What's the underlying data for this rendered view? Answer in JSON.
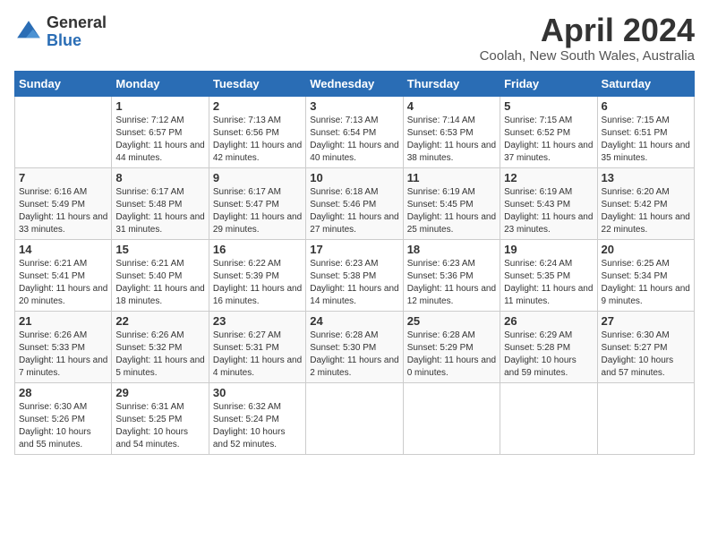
{
  "header": {
    "logo_general": "General",
    "logo_blue": "Blue",
    "month_title": "April 2024",
    "location": "Coolah, New South Wales, Australia"
  },
  "calendar": {
    "weekdays": [
      "Sunday",
      "Monday",
      "Tuesday",
      "Wednesday",
      "Thursday",
      "Friday",
      "Saturday"
    ],
    "weeks": [
      [
        {
          "day": "",
          "sunrise": "",
          "sunset": "",
          "daylight": ""
        },
        {
          "day": "1",
          "sunrise": "Sunrise: 7:12 AM",
          "sunset": "Sunset: 6:57 PM",
          "daylight": "Daylight: 11 hours and 44 minutes."
        },
        {
          "day": "2",
          "sunrise": "Sunrise: 7:13 AM",
          "sunset": "Sunset: 6:56 PM",
          "daylight": "Daylight: 11 hours and 42 minutes."
        },
        {
          "day": "3",
          "sunrise": "Sunrise: 7:13 AM",
          "sunset": "Sunset: 6:54 PM",
          "daylight": "Daylight: 11 hours and 40 minutes."
        },
        {
          "day": "4",
          "sunrise": "Sunrise: 7:14 AM",
          "sunset": "Sunset: 6:53 PM",
          "daylight": "Daylight: 11 hours and 38 minutes."
        },
        {
          "day": "5",
          "sunrise": "Sunrise: 7:15 AM",
          "sunset": "Sunset: 6:52 PM",
          "daylight": "Daylight: 11 hours and 37 minutes."
        },
        {
          "day": "6",
          "sunrise": "Sunrise: 7:15 AM",
          "sunset": "Sunset: 6:51 PM",
          "daylight": "Daylight: 11 hours and 35 minutes."
        }
      ],
      [
        {
          "day": "7",
          "sunrise": "Sunrise: 6:16 AM",
          "sunset": "Sunset: 5:49 PM",
          "daylight": "Daylight: 11 hours and 33 minutes."
        },
        {
          "day": "8",
          "sunrise": "Sunrise: 6:17 AM",
          "sunset": "Sunset: 5:48 PM",
          "daylight": "Daylight: 11 hours and 31 minutes."
        },
        {
          "day": "9",
          "sunrise": "Sunrise: 6:17 AM",
          "sunset": "Sunset: 5:47 PM",
          "daylight": "Daylight: 11 hours and 29 minutes."
        },
        {
          "day": "10",
          "sunrise": "Sunrise: 6:18 AM",
          "sunset": "Sunset: 5:46 PM",
          "daylight": "Daylight: 11 hours and 27 minutes."
        },
        {
          "day": "11",
          "sunrise": "Sunrise: 6:19 AM",
          "sunset": "Sunset: 5:45 PM",
          "daylight": "Daylight: 11 hours and 25 minutes."
        },
        {
          "day": "12",
          "sunrise": "Sunrise: 6:19 AM",
          "sunset": "Sunset: 5:43 PM",
          "daylight": "Daylight: 11 hours and 23 minutes."
        },
        {
          "day": "13",
          "sunrise": "Sunrise: 6:20 AM",
          "sunset": "Sunset: 5:42 PM",
          "daylight": "Daylight: 11 hours and 22 minutes."
        }
      ],
      [
        {
          "day": "14",
          "sunrise": "Sunrise: 6:21 AM",
          "sunset": "Sunset: 5:41 PM",
          "daylight": "Daylight: 11 hours and 20 minutes."
        },
        {
          "day": "15",
          "sunrise": "Sunrise: 6:21 AM",
          "sunset": "Sunset: 5:40 PM",
          "daylight": "Daylight: 11 hours and 18 minutes."
        },
        {
          "day": "16",
          "sunrise": "Sunrise: 6:22 AM",
          "sunset": "Sunset: 5:39 PM",
          "daylight": "Daylight: 11 hours and 16 minutes."
        },
        {
          "day": "17",
          "sunrise": "Sunrise: 6:23 AM",
          "sunset": "Sunset: 5:38 PM",
          "daylight": "Daylight: 11 hours and 14 minutes."
        },
        {
          "day": "18",
          "sunrise": "Sunrise: 6:23 AM",
          "sunset": "Sunset: 5:36 PM",
          "daylight": "Daylight: 11 hours and 12 minutes."
        },
        {
          "day": "19",
          "sunrise": "Sunrise: 6:24 AM",
          "sunset": "Sunset: 5:35 PM",
          "daylight": "Daylight: 11 hours and 11 minutes."
        },
        {
          "day": "20",
          "sunrise": "Sunrise: 6:25 AM",
          "sunset": "Sunset: 5:34 PM",
          "daylight": "Daylight: 11 hours and 9 minutes."
        }
      ],
      [
        {
          "day": "21",
          "sunrise": "Sunrise: 6:26 AM",
          "sunset": "Sunset: 5:33 PM",
          "daylight": "Daylight: 11 hours and 7 minutes."
        },
        {
          "day": "22",
          "sunrise": "Sunrise: 6:26 AM",
          "sunset": "Sunset: 5:32 PM",
          "daylight": "Daylight: 11 hours and 5 minutes."
        },
        {
          "day": "23",
          "sunrise": "Sunrise: 6:27 AM",
          "sunset": "Sunset: 5:31 PM",
          "daylight": "Daylight: 11 hours and 4 minutes."
        },
        {
          "day": "24",
          "sunrise": "Sunrise: 6:28 AM",
          "sunset": "Sunset: 5:30 PM",
          "daylight": "Daylight: 11 hours and 2 minutes."
        },
        {
          "day": "25",
          "sunrise": "Sunrise: 6:28 AM",
          "sunset": "Sunset: 5:29 PM",
          "daylight": "Daylight: 11 hours and 0 minutes."
        },
        {
          "day": "26",
          "sunrise": "Sunrise: 6:29 AM",
          "sunset": "Sunset: 5:28 PM",
          "daylight": "Daylight: 10 hours and 59 minutes."
        },
        {
          "day": "27",
          "sunrise": "Sunrise: 6:30 AM",
          "sunset": "Sunset: 5:27 PM",
          "daylight": "Daylight: 10 hours and 57 minutes."
        }
      ],
      [
        {
          "day": "28",
          "sunrise": "Sunrise: 6:30 AM",
          "sunset": "Sunset: 5:26 PM",
          "daylight": "Daylight: 10 hours and 55 minutes."
        },
        {
          "day": "29",
          "sunrise": "Sunrise: 6:31 AM",
          "sunset": "Sunset: 5:25 PM",
          "daylight": "Daylight: 10 hours and 54 minutes."
        },
        {
          "day": "30",
          "sunrise": "Sunrise: 6:32 AM",
          "sunset": "Sunset: 5:24 PM",
          "daylight": "Daylight: 10 hours and 52 minutes."
        },
        {
          "day": "",
          "sunrise": "",
          "sunset": "",
          "daylight": ""
        },
        {
          "day": "",
          "sunrise": "",
          "sunset": "",
          "daylight": ""
        },
        {
          "day": "",
          "sunrise": "",
          "sunset": "",
          "daylight": ""
        },
        {
          "day": "",
          "sunrise": "",
          "sunset": "",
          "daylight": ""
        }
      ]
    ]
  }
}
